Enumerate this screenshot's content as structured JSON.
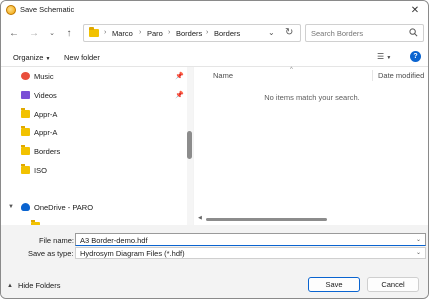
{
  "window": {
    "title": "Save Schematic"
  },
  "address": {
    "breadcrumbs": [
      "Marco",
      "Paro",
      "Borders",
      "Borders"
    ]
  },
  "search": {
    "placeholder": "Search Borders"
  },
  "toolbar": {
    "organize_label": "Organize",
    "new_folder_label": "New folder",
    "help_label": "?"
  },
  "navpane": {
    "items": [
      {
        "label": "Music",
        "icon": "music-icon"
      },
      {
        "label": "Videos",
        "icon": "video-icon"
      },
      {
        "label": "Appr-A",
        "icon": "folder-icon"
      },
      {
        "label": "Appr-A",
        "icon": "folder-icon"
      },
      {
        "label": "Borders",
        "icon": "folder-icon"
      },
      {
        "label": "ISO",
        "icon": "folder-icon"
      },
      {
        "label": "OneDrive - PARO",
        "icon": "cloud-icon"
      }
    ]
  },
  "filelist": {
    "columns": {
      "name": "Name",
      "date": "Date modified"
    },
    "empty_message": "No items match your search."
  },
  "form": {
    "filename_label": "File name:",
    "filename_value": "A3 Border-demo.hdf",
    "filetype_label": "Save as type:",
    "filetype_value": "Hydrosym Diagram Files (*.hdf)",
    "hide_folders_label": "Hide Folders",
    "save_label": "Save",
    "cancel_label": "Cancel"
  },
  "colors": {
    "accent": "#0a64d0",
    "folder": "#f2c200"
  }
}
